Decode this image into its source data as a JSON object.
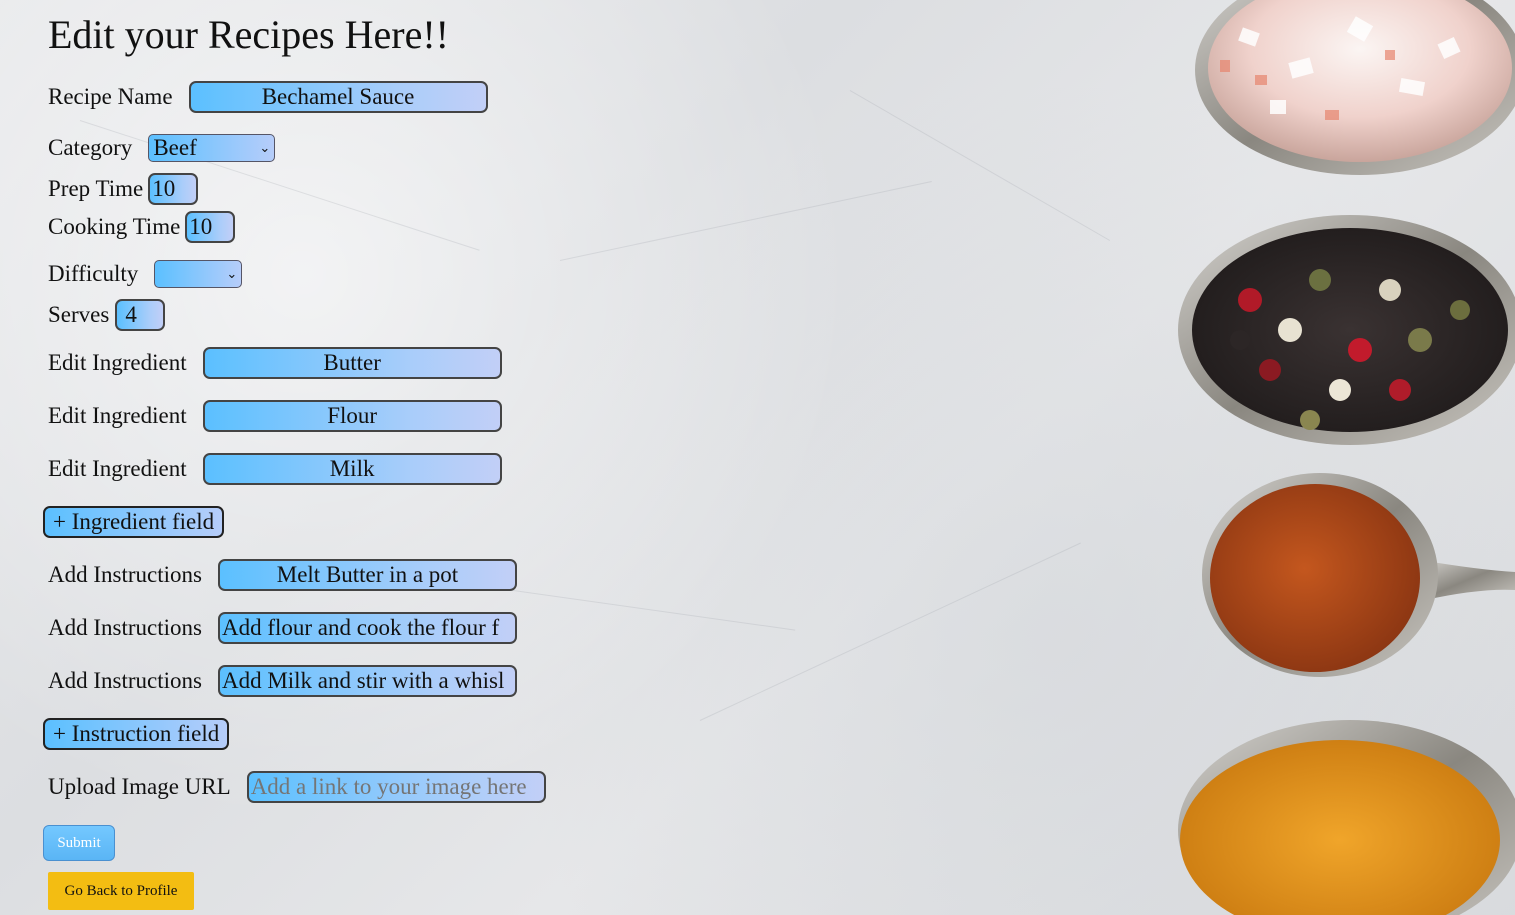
{
  "title": "Edit your Recipes Here!!",
  "recipe_name": {
    "label": "Recipe Name",
    "value": "Bechamel Sauce"
  },
  "category": {
    "label": "Category",
    "value": "Beef"
  },
  "prep_time": {
    "label": "Prep Time",
    "value": "10"
  },
  "cooking_time": {
    "label": "Cooking Time",
    "value": "10"
  },
  "difficulty": {
    "label": "Difficulty",
    "value": ""
  },
  "serves": {
    "label": "Serves",
    "value": "4"
  },
  "ingredients": [
    {
      "label": "Edit Ingredient",
      "value": "Butter"
    },
    {
      "label": "Edit Ingredient",
      "value": "Flour"
    },
    {
      "label": "Edit Ingredient",
      "value": "Milk"
    }
  ],
  "add_ingredient_label": "+ Ingredient field",
  "instructions": [
    {
      "label": "Add Instructions",
      "value": "Melt Butter in a pot"
    },
    {
      "label": "Add Instructions",
      "value": "Add flour and cook the flour f"
    },
    {
      "label": "Add Instructions",
      "value": "Add Milk and stir with a whisl"
    }
  ],
  "add_instruction_label": "+ Instruction field",
  "image_url": {
    "label": "Upload Image URL",
    "placeholder": "Add a link to your image here"
  },
  "submit_label": "Submit",
  "back_label": "Go Back to Profile",
  "colors": {
    "field_start": "#5bc0ff",
    "field_end": "#c2cff7",
    "back_button": "#f3bd12"
  }
}
